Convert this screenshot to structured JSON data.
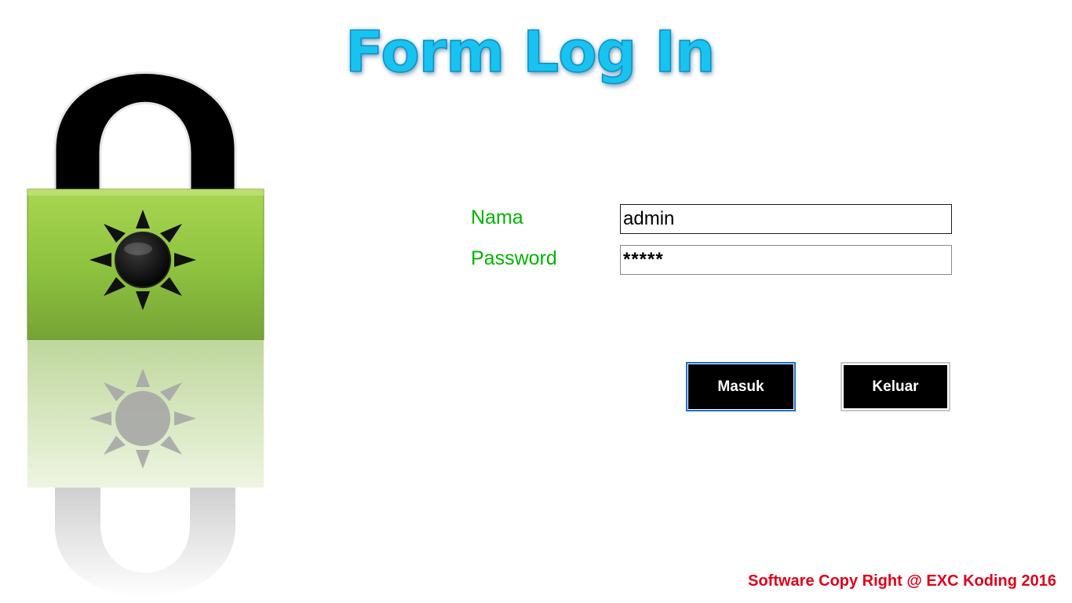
{
  "title": "Form Log In",
  "form": {
    "nama_label": "Nama",
    "nama_value": "admin",
    "password_label": "Password",
    "password_value": "*****"
  },
  "buttons": {
    "masuk": "Masuk",
    "keluar": "Keluar"
  },
  "footer": "Software Copy Right @ EXC Koding 2016",
  "colors": {
    "title": "#18c3f0",
    "label": "#00b400",
    "footer": "#e0001b",
    "lock_body": "#8fc440",
    "button_bg": "#000000"
  },
  "icons": [
    "padlock-icon",
    "sun-icon"
  ]
}
